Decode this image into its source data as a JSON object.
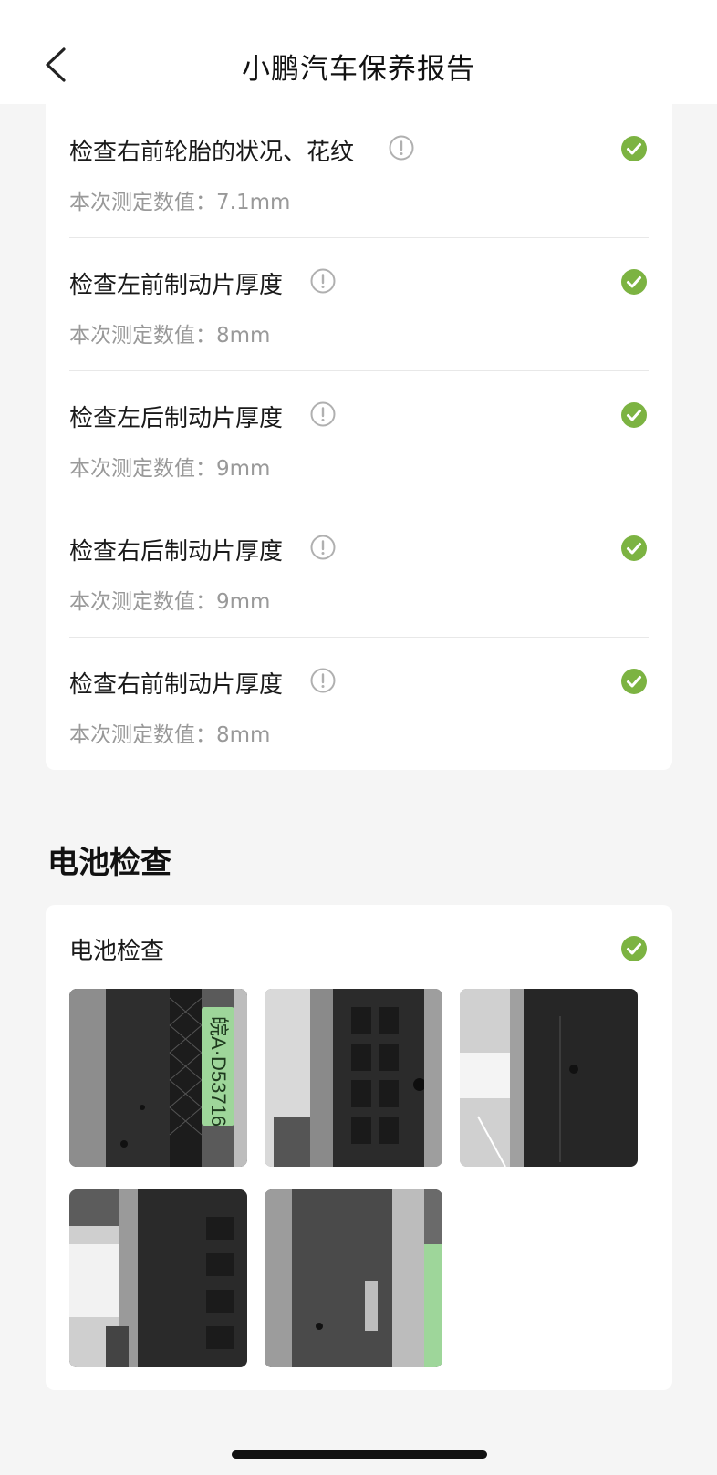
{
  "header": {
    "title": "小鹏汽车保养报告"
  },
  "items": [
    {
      "title": "检查右前轮胎的状况、花纹",
      "value": "本次测定数值：7.1mm"
    },
    {
      "title": "检查左前制动片厚度",
      "value": "本次测定数值：8mm"
    },
    {
      "title": "检查左后制动片厚度",
      "value": "本次测定数值：9mm"
    },
    {
      "title": "检查右后制动片厚度",
      "value": "本次测定数值：9mm"
    },
    {
      "title": "检查右前制动片厚度",
      "value": "本次测定数值：8mm"
    }
  ],
  "battery": {
    "section_title": "电池检查",
    "item_label": "电池检查",
    "plate_text": "皖A·D53716"
  },
  "colors": {
    "check_green": "#7cb342",
    "info_gray": "#b0b0b0"
  }
}
